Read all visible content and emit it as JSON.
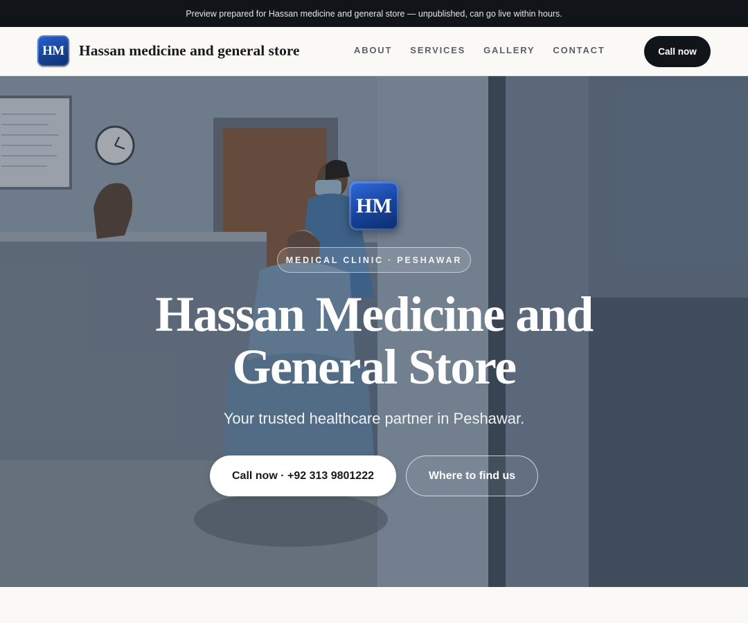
{
  "announcement": "Preview prepared for Hassan medicine and general store — unpublished, can go live within hours.",
  "header": {
    "logo_text": "HM",
    "brand_name": "Hassan medicine and general store",
    "nav": [
      {
        "label": "ABOUT"
      },
      {
        "label": "SERVICES"
      },
      {
        "label": "GALLERY"
      },
      {
        "label": "CONTACT"
      }
    ],
    "cta_label": "Call now"
  },
  "hero": {
    "logo_text": "HM",
    "tag": "MEDICAL CLINIC · PESHAWAR",
    "title": "Hassan Medicine and General Store",
    "subtitle": "Your trusted healthcare partner in Peshawar.",
    "primary_button": "Call now · +92 313 9801222",
    "secondary_button": "Where to find us"
  },
  "colors": {
    "topbar_bg": "#111418",
    "brand_blue": "#17449a",
    "cta_dark": "#111418",
    "page_bg": "#faf9f6"
  }
}
